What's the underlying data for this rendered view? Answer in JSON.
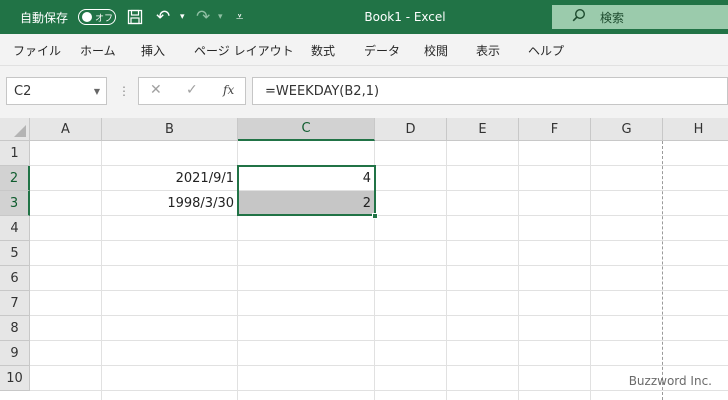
{
  "titlebar": {
    "autosave_label": "自動保存",
    "autosave_state": "オフ",
    "doc_title": "Book1  -  Excel",
    "search_placeholder": "検索"
  },
  "ribbon_tabs": [
    "ファイル",
    "ホーム",
    "挿入",
    "ページ レイアウト",
    "数式",
    "データ",
    "校閲",
    "表示",
    "ヘルプ"
  ],
  "formula_bar": {
    "name_box": "C2",
    "formula": "=WEEKDAY(B2,1)"
  },
  "columns": [
    "A",
    "B",
    "C",
    "D",
    "E",
    "F",
    "G",
    "H"
  ],
  "rows": [
    "1",
    "2",
    "3",
    "4",
    "5",
    "6",
    "7",
    "8",
    "9",
    "10"
  ],
  "cells": {
    "B2": "2021/9/1",
    "B3": "1998/3/30",
    "C2": "4",
    "C3": "2"
  },
  "selection": "C2:C3",
  "watermark": "Buzzword Inc.",
  "colors": {
    "accent": "#217346",
    "selection_fill": "#c6c6c6"
  }
}
